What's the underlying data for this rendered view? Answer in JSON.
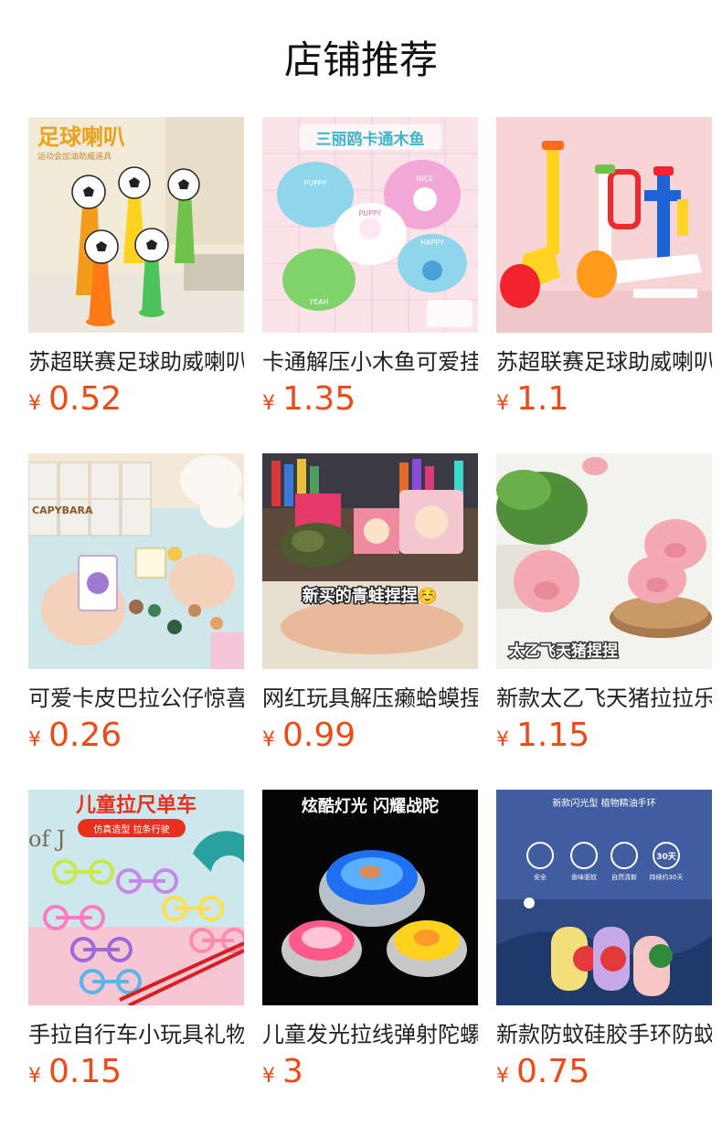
{
  "page": {
    "title": "店铺推荐"
  },
  "currency_symbol": "¥",
  "products": [
    {
      "name": "苏超联赛足球助威喇叭",
      "price": "0.52",
      "image_text": "足球喇叭",
      "image_subtext": "运动会加油助威道具"
    },
    {
      "name": "卡通解压小木鱼可爱挂件",
      "price": "1.35",
      "image_text": "三丽鸥卡通木鱼",
      "image_tags": [
        "PUPPY",
        "NICE",
        "PUPPY",
        "YEAH",
        "HAPPY"
      ]
    },
    {
      "name": "苏超联赛足球助威喇叭",
      "price": "1.1"
    },
    {
      "name": "可爱卡皮巴拉公仔惊喜盲盒",
      "price": "0.26",
      "image_text": "CAPYBARA"
    },
    {
      "name": "网红玩具解压癞蛤蟆捏捏乐",
      "price": "0.99",
      "image_text": "新买的青蛙捏捏☺️"
    },
    {
      "name": "新款太乙飞天猪拉拉乐",
      "price": "1.15",
      "image_text": "太乙飞天猪捏捏"
    },
    {
      "name": "手拉自行车小玩具礼物",
      "price": "0.15",
      "image_text": "儿童拉尺单车",
      "image_subtext": "仿真造型 拉条行驶",
      "image_extra": "of J"
    },
    {
      "name": "儿童发光拉线弹射陀螺",
      "price": "3",
      "image_text": "炫酷灯光 闪耀战陀"
    },
    {
      "name": "新款防蚊硅胶手环防蚊",
      "price": "0.75",
      "image_text": "新款闪光型 植物精油手环",
      "image_icons": [
        "安全",
        "香味驱蚊",
        "自然清新",
        "持续约30天"
      ],
      "image_badge": "30天"
    }
  ]
}
